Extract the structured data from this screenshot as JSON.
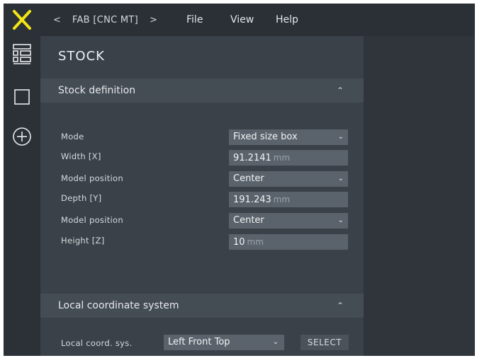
{
  "app": {
    "logo_icon": "x-logo-icon",
    "accent_color": "#f2e614"
  },
  "rail": {
    "items": [
      {
        "icon": "list-view-icon"
      },
      {
        "icon": "square-icon"
      },
      {
        "icon": "add-circle-icon"
      }
    ]
  },
  "topbar": {
    "project_name": "FAB [CNC MT]",
    "menu": [
      "File",
      "View",
      "Help"
    ]
  },
  "panel": {
    "title": "STOCK",
    "stock_section": {
      "label": "Stock definition",
      "rows": [
        {
          "label": "Mode",
          "type": "select",
          "value": "Fixed size box"
        },
        {
          "label": "Width [X]",
          "type": "input",
          "value": "91.2141",
          "unit": "mm"
        },
        {
          "label": "Model position",
          "type": "select",
          "value": "Center"
        },
        {
          "label": "Depth [Y]",
          "type": "input",
          "value": "191.243",
          "unit": "mm"
        },
        {
          "label": "Model position",
          "type": "select",
          "value": "Center"
        },
        {
          "label": "Height [Z]",
          "type": "input",
          "value": "10",
          "unit": "mm"
        }
      ]
    },
    "coord_section": {
      "label": "Local coordinate system",
      "field_label": "Local coord. sys.",
      "value": "Left Front Top",
      "button_label": "SELECT"
    }
  }
}
